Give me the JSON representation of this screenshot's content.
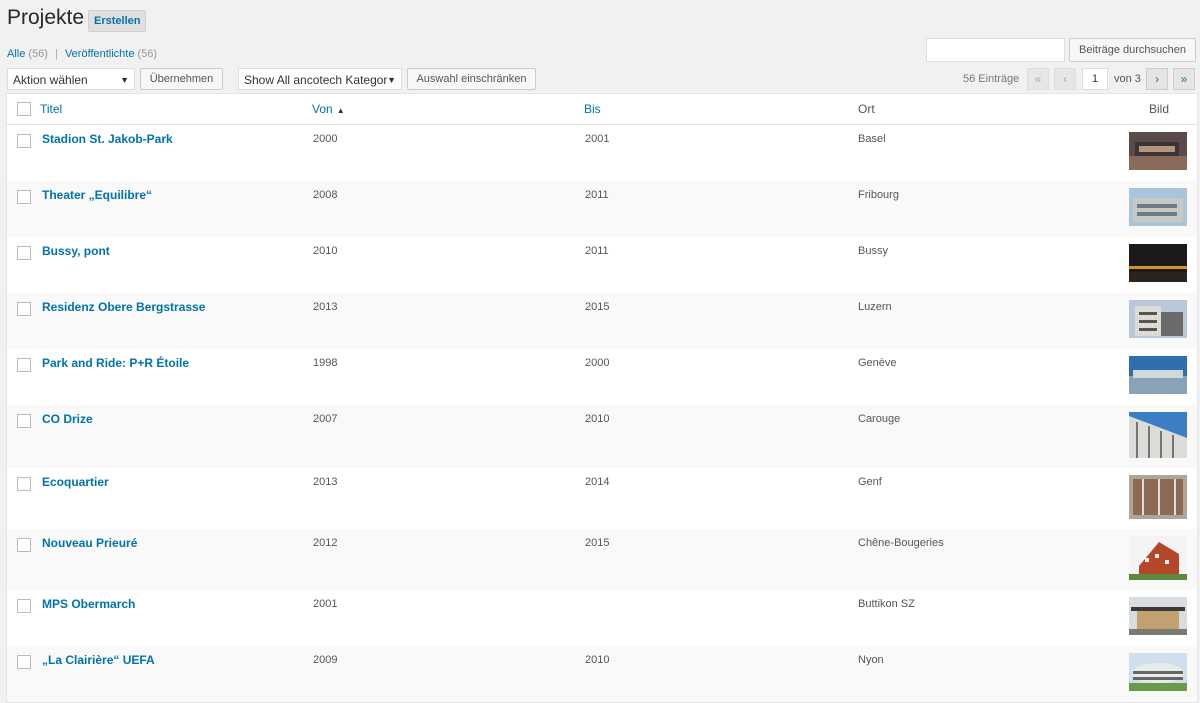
{
  "header": {
    "title": "Projekte",
    "add_new": "Erstellen"
  },
  "views": {
    "all_label": "Alle",
    "all_count": "(56)",
    "published_label": "Veröffentlichte",
    "published_count": "(56)",
    "sep": "|"
  },
  "search": {
    "button": "Beiträge durchsuchen",
    "value": ""
  },
  "tablenav": {
    "bulk_action": "Aktion wählen",
    "apply": "Übernehmen",
    "category_filter": "Show All ancotech Kategor",
    "filter": "Auswahl einschränken",
    "items_count": "56 Einträge",
    "first": "«",
    "prev": "‹",
    "next": "›",
    "last": "»",
    "current_page": "1",
    "of_pages": "von 3"
  },
  "columns": {
    "title": "Titel",
    "von": "Von",
    "bis": "Bis",
    "ort": "Ort",
    "bild": "Bild",
    "sort_arrow": "▲"
  },
  "rows": [
    {
      "title": "Stadion St. Jakob-Park",
      "von": "2000",
      "bis": "2001",
      "ort": "Basel"
    },
    {
      "title": "Theater „Equilibre“",
      "von": "2008",
      "bis": "2011",
      "ort": "Fribourg"
    },
    {
      "title": "Bussy, pont",
      "von": "2010",
      "bis": "2011",
      "ort": "Bussy"
    },
    {
      "title": "Residenz Obere Bergstrasse",
      "von": "2013",
      "bis": "2015",
      "ort": "Luzern"
    },
    {
      "title": "Park and Ride: P+R Étoile",
      "von": "1998",
      "bis": "2000",
      "ort": "Genève"
    },
    {
      "title": "CO Drize",
      "von": "2007",
      "bis": "2010",
      "ort": "Carouge"
    },
    {
      "title": "Ecoquartier",
      "von": "2013",
      "bis": "2014",
      "ort": "Genf"
    },
    {
      "title": "Nouveau Prieuré",
      "von": "2012",
      "bis": "2015",
      "ort": "Chêne-Bougeries"
    },
    {
      "title": "MPS Obermarch",
      "von": "2001",
      "bis": "",
      "ort": "Buttikon SZ"
    },
    {
      "title": "„La Clairière“ UEFA",
      "von": "2009",
      "bis": "2010",
      "ort": "Nyon"
    }
  ]
}
